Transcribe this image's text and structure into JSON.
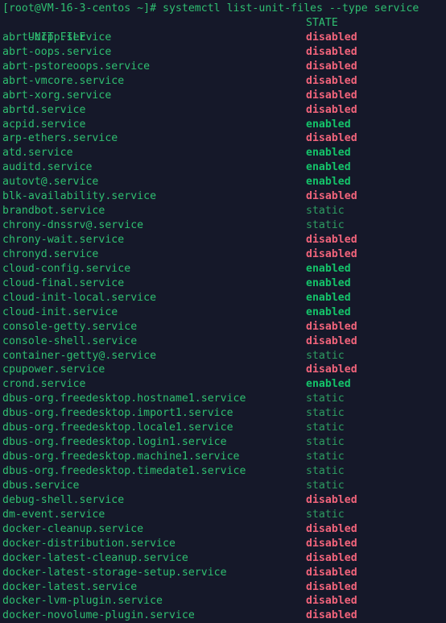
{
  "terminal": {
    "background_color": "#151829",
    "prompt": "[root@VM-16-3-centos ~]#",
    "command": "systemctl list-unit-files --type service",
    "prompt_line": "[root@VM-16-3-centos ~]# systemctl list-unit-files --type service",
    "colors": {
      "text_green": "#2fbf71",
      "enabled": "#14c46a",
      "disabled": "#f2647b",
      "static": "#2e9e62"
    },
    "columns": {
      "unit_file": "UNIT FILE",
      "state": "STATE"
    },
    "rows": [
      {
        "unit": "abrt-ccpp.service",
        "state": "disabled"
      },
      {
        "unit": "abrt-oops.service",
        "state": "disabled"
      },
      {
        "unit": "abrt-pstoreoops.service",
        "state": "disabled"
      },
      {
        "unit": "abrt-vmcore.service",
        "state": "disabled"
      },
      {
        "unit": "abrt-xorg.service",
        "state": "disabled"
      },
      {
        "unit": "abrtd.service",
        "state": "disabled"
      },
      {
        "unit": "acpid.service",
        "state": "enabled"
      },
      {
        "unit": "arp-ethers.service",
        "state": "disabled"
      },
      {
        "unit": "atd.service",
        "state": "enabled"
      },
      {
        "unit": "auditd.service",
        "state": "enabled"
      },
      {
        "unit": "autovt@.service",
        "state": "enabled"
      },
      {
        "unit": "blk-availability.service",
        "state": "disabled"
      },
      {
        "unit": "brandbot.service",
        "state": "static"
      },
      {
        "unit": "chrony-dnssrv@.service",
        "state": "static"
      },
      {
        "unit": "chrony-wait.service",
        "state": "disabled"
      },
      {
        "unit": "chronyd.service",
        "state": "disabled"
      },
      {
        "unit": "cloud-config.service",
        "state": "enabled"
      },
      {
        "unit": "cloud-final.service",
        "state": "enabled"
      },
      {
        "unit": "cloud-init-local.service",
        "state": "enabled"
      },
      {
        "unit": "cloud-init.service",
        "state": "enabled"
      },
      {
        "unit": "console-getty.service",
        "state": "disabled"
      },
      {
        "unit": "console-shell.service",
        "state": "disabled"
      },
      {
        "unit": "container-getty@.service",
        "state": "static"
      },
      {
        "unit": "cpupower.service",
        "state": "disabled"
      },
      {
        "unit": "crond.service",
        "state": "enabled"
      },
      {
        "unit": "dbus-org.freedesktop.hostname1.service",
        "state": "static"
      },
      {
        "unit": "dbus-org.freedesktop.import1.service",
        "state": "static"
      },
      {
        "unit": "dbus-org.freedesktop.locale1.service",
        "state": "static"
      },
      {
        "unit": "dbus-org.freedesktop.login1.service",
        "state": "static"
      },
      {
        "unit": "dbus-org.freedesktop.machine1.service",
        "state": "static"
      },
      {
        "unit": "dbus-org.freedesktop.timedate1.service",
        "state": "static"
      },
      {
        "unit": "dbus.service",
        "state": "static"
      },
      {
        "unit": "debug-shell.service",
        "state": "disabled"
      },
      {
        "unit": "dm-event.service",
        "state": "static"
      },
      {
        "unit": "docker-cleanup.service",
        "state": "disabled"
      },
      {
        "unit": "docker-distribution.service",
        "state": "disabled"
      },
      {
        "unit": "docker-latest-cleanup.service",
        "state": "disabled"
      },
      {
        "unit": "docker-latest-storage-setup.service",
        "state": "disabled"
      },
      {
        "unit": "docker-latest.service",
        "state": "disabled"
      },
      {
        "unit": "docker-lvm-plugin.service",
        "state": "disabled"
      },
      {
        "unit": "docker-novolume-plugin.service",
        "state": "disabled"
      }
    ]
  }
}
